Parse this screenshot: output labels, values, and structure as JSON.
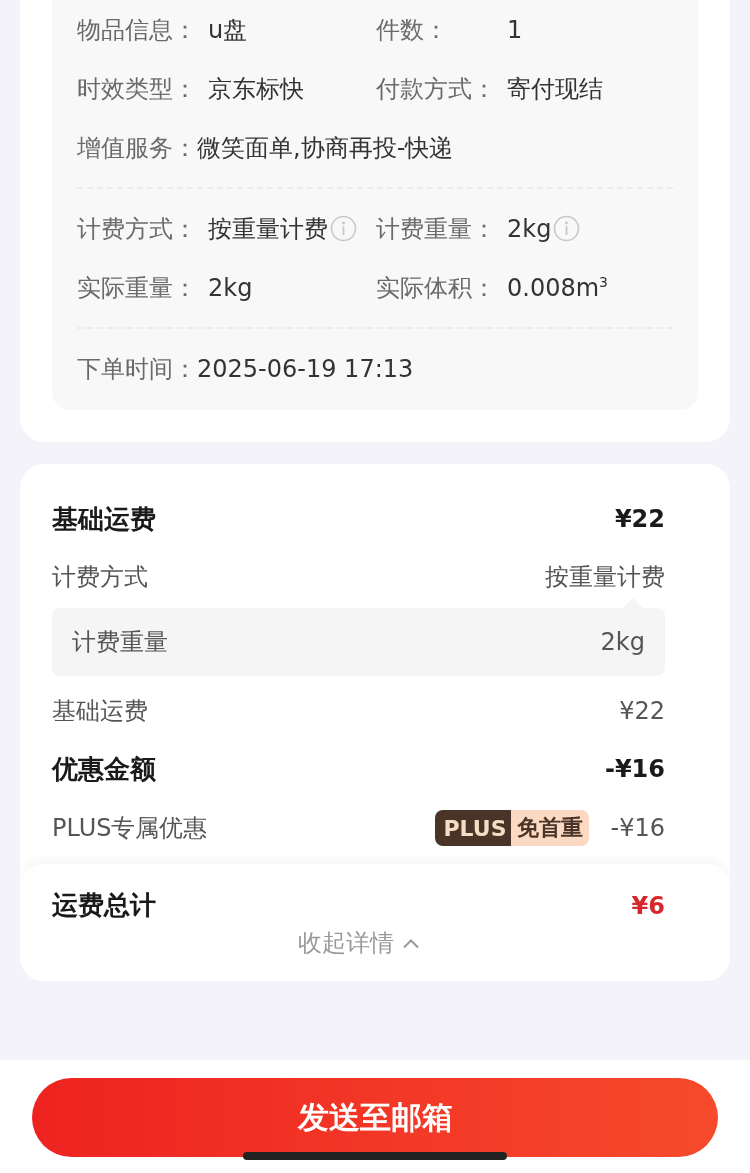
{
  "shipment_info": {
    "groups": [
      {
        "rows": [
          [
            {
              "label": "物品信息：",
              "value": "u盘",
              "has_info": false
            },
            {
              "label": "件数：",
              "value": "1",
              "has_info": false
            }
          ],
          [
            {
              "label": "时效类型：",
              "value": "京东标快",
              "has_info": false
            },
            {
              "label": "付款方式：",
              "value": "寄付现结",
              "has_info": false
            }
          ],
          [
            {
              "label": "增值服务：",
              "value": "微笑面单,协商再投-快递",
              "has_info": false
            }
          ]
        ]
      },
      {
        "rows": [
          [
            {
              "label": "计费方式：",
              "value": "按重量计费",
              "has_info": true
            },
            {
              "label": "计费重量：",
              "value": "2kg",
              "has_info": true
            }
          ],
          [
            {
              "label": "实际重量：",
              "value": "2kg",
              "has_info": false
            },
            {
              "label": "实际体积：",
              "value": "0.008m$^{3}$",
              "has_info": false
            }
          ]
        ]
      },
      {
        "rows": [
          [
            {
              "label": "下单时间：",
              "value": "2025-06-19 17:13",
              "has_info": false
            }
          ]
        ]
      }
    ]
  },
  "fees": {
    "lines": [
      {
        "kind": "heading",
        "label": "基础运费",
        "amount": "¥22"
      },
      {
        "kind": "line",
        "label": "计费方式",
        "amount": "按重量计费"
      },
      {
        "kind": "detail",
        "label": "计费重量",
        "amount": "2kg"
      },
      {
        "kind": "line",
        "label": "基础运费",
        "amount": "¥22"
      },
      {
        "kind": "heading",
        "label": "优惠金额",
        "amount": "-¥16"
      },
      {
        "kind": "badge_line",
        "label": "PLUS专属优惠",
        "badge": [
          "PLUS",
          "免首重"
        ],
        "amount": "-¥16"
      }
    ],
    "total": {
      "label": "运费总计",
      "amount": "¥6"
    },
    "collapse_link": "收起详情"
  },
  "send_button": "发送至邮箱"
}
